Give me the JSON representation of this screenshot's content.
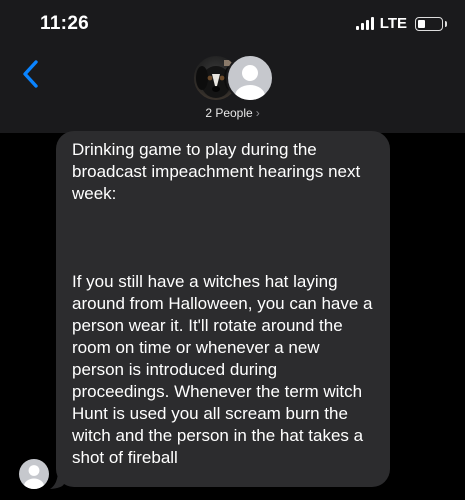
{
  "status_bar": {
    "time": "11:26",
    "network": "LTE"
  },
  "header": {
    "group_label": "2 People",
    "chevron": "›"
  },
  "message": {
    "paragraph_1": "Drinking game to play during the broadcast impeachment hearings next week:",
    "paragraph_2": "If you still have a witches hat laying around from Halloween, you can have a person wear it. It'll rotate around the room on time or whenever a new person is introduced during proceedings. Whenever the term witch Hunt is used you all scream burn the witch and the person in the hat takes a shot of fireball"
  },
  "colors": {
    "accent": "#0a84ff",
    "bubble": "#2c2c2e",
    "header_bg": "#1a1a1c"
  }
}
